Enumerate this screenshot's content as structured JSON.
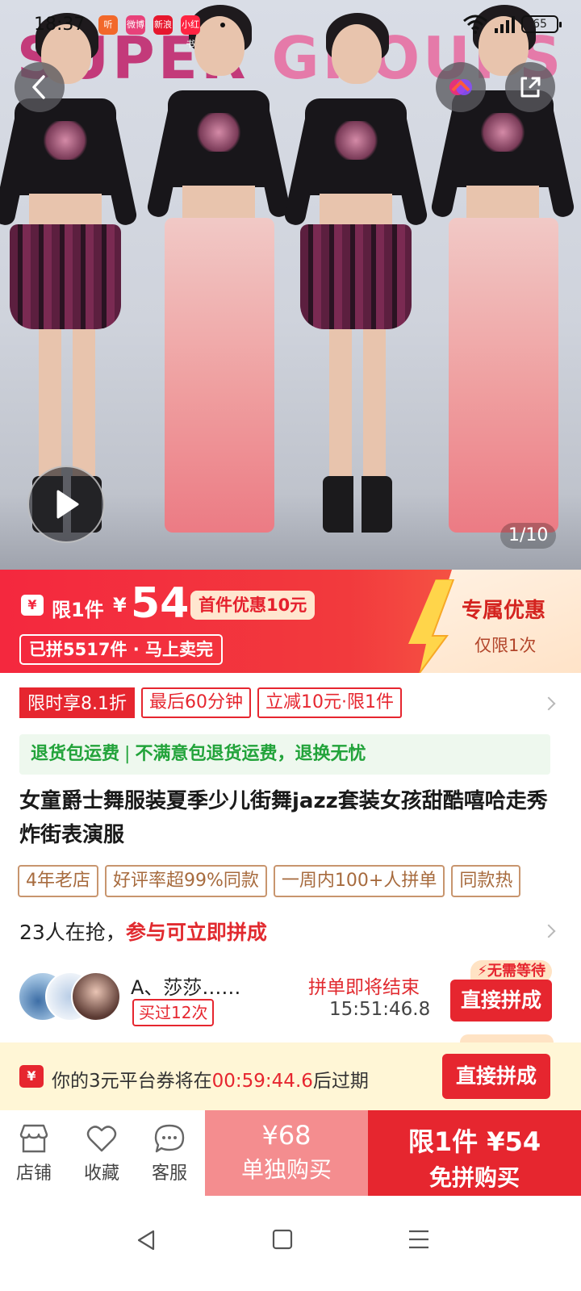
{
  "status_bar": {
    "time": "18:37",
    "apps": [
      "听",
      "微博",
      "新浪",
      "小红书"
    ],
    "battery": "65"
  },
  "hero": {
    "brand_left": "SUPER",
    "brand_right": "GROUPS",
    "image_counter": "1/10"
  },
  "price_banner": {
    "limit_label": "限1件",
    "currency": "¥",
    "price": "54",
    "first_discount": "首件优惠10元",
    "sold_info": "已拼5517件 · 马上卖完",
    "exclusive_title": "专属优惠",
    "exclusive_sub": "仅限1次"
  },
  "promos": {
    "discount": "限时享8.1折",
    "last_minutes": "最后60分钟",
    "instant_off": "立减10元·限1件"
  },
  "returns": {
    "part1": "退货包运费",
    "sep": "|",
    "part2": "不满意包退货运费，退换无忧"
  },
  "product": {
    "title": "女童爵士舞服装夏季少儿街舞jazz套装女孩甜酷嘻哈走秀炸街表演服"
  },
  "badges": [
    "4年老店",
    "好评率超99%同款",
    "一周内100+人拼单",
    "同款热"
  ],
  "group": {
    "count_text": "23人在抢，",
    "cta_text": "参与可立即拼成",
    "user_name": "A、莎莎……",
    "bought_times": "买过12次",
    "ending_label": "拼单即将结束",
    "timer": "15:51:46.8",
    "no_wait": "无需等待",
    "join_label": "直接拼成"
  },
  "voucher": {
    "icon": "¥",
    "text_prefix": "你的3元平台券将在",
    "countdown": "00:59:44.6",
    "text_suffix": "后过期",
    "button": "直接拼成"
  },
  "bottom_bar": {
    "shop": "店铺",
    "favorite": "收藏",
    "service": "客服",
    "single_price": "¥68",
    "single_label": "单独购买",
    "group_price": "限1件 ¥54",
    "group_label": "免拼购买"
  },
  "colors": {
    "accent_red": "#e6262f",
    "single_buy": "#f48d8f",
    "return_green": "#22a33a"
  }
}
